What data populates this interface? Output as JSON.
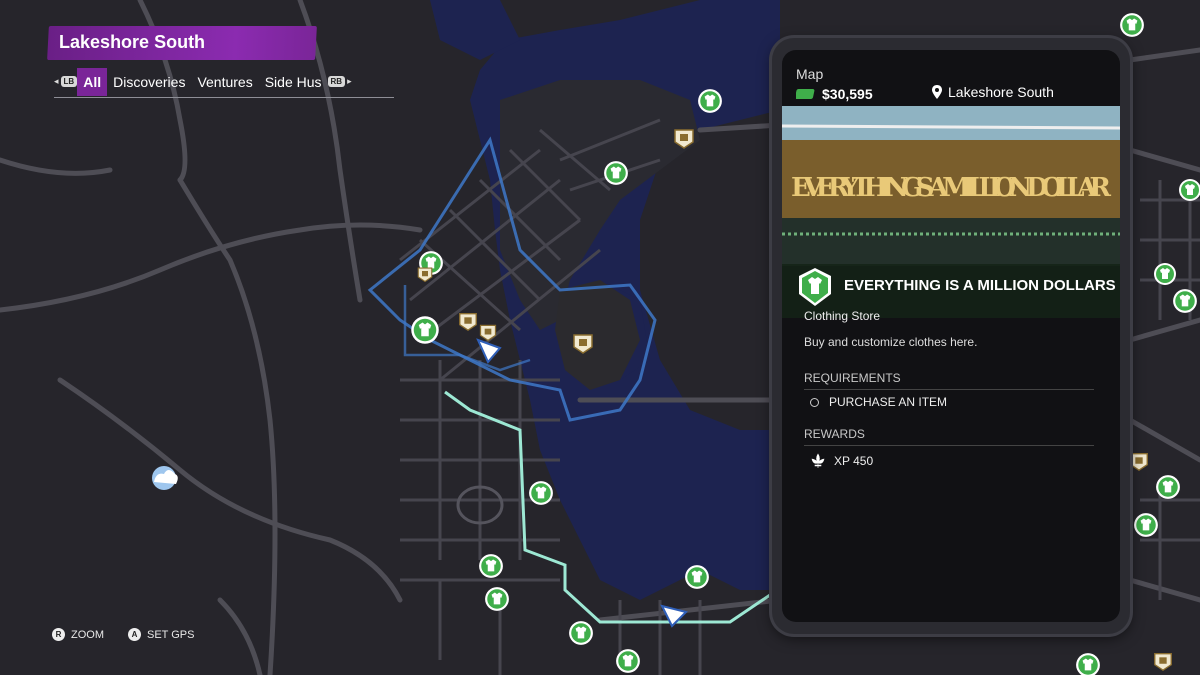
{
  "header": {
    "region_title": "Lakeshore South",
    "left_bumper": "LB",
    "right_bumper": "RB",
    "tabs": [
      {
        "label": "All",
        "active": true
      },
      {
        "label": "Discoveries",
        "active": false
      },
      {
        "label": "Ventures",
        "active": false
      },
      {
        "label": "Side Hus",
        "active": false
      }
    ]
  },
  "hints": [
    {
      "button": "R",
      "label": "ZOOM"
    },
    {
      "button": "A",
      "label": "SET GPS"
    }
  ],
  "phone": {
    "title": "Map",
    "cash": "$30,595",
    "location": "Lakeshore South",
    "photo_sign_text": "EVERYTHING'S A MILLION DOLLAR",
    "store_name": "EVERYTHING IS A MILLION DOLLARS",
    "store_type": "Clothing Store",
    "description": "Buy and customize clothes here.",
    "requirements_header": "REQUIREMENTS",
    "requirement": "PURCHASE AN ITEM",
    "rewards_header": "REWARDS",
    "reward": "XP 450"
  },
  "colors": {
    "accent_purple": "#7a2598",
    "water": "#1d2350",
    "land": "#26252b",
    "road": "#4e4d55",
    "gps_route": "#9de8d4",
    "district_border": "#3e78c8",
    "clothing_icon": "#3fae4a"
  },
  "map_icons": [
    "clothing-store-icon",
    "business-venture-icon",
    "player-arrow-icon",
    "weather-collectible-icon"
  ]
}
